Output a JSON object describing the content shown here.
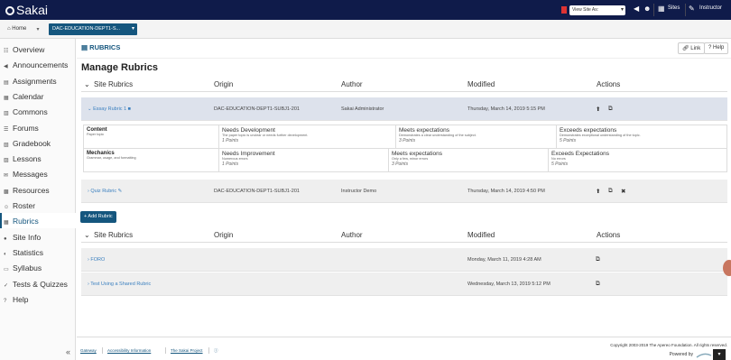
{
  "topbar": {
    "logo_text": "Sakai",
    "view_as": "View Site As:",
    "sites_label": "Sites",
    "user_label": "Instructor"
  },
  "sitebar": {
    "home_label": "Home",
    "site_label": "DAC-EDUCATION-DEPT1-S..."
  },
  "sidebar": {
    "items": [
      {
        "label": "Overview",
        "icon": "overview-icon"
      },
      {
        "label": "Announcements",
        "icon": "megaphone-icon"
      },
      {
        "label": "Assignments",
        "icon": "assignments-icon"
      },
      {
        "label": "Calendar",
        "icon": "calendar-icon"
      },
      {
        "label": "Commons",
        "icon": "commons-icon"
      },
      {
        "label": "Forums",
        "icon": "forums-icon"
      },
      {
        "label": "Gradebook",
        "icon": "gradebook-icon"
      },
      {
        "label": "Lessons",
        "icon": "lessons-icon"
      },
      {
        "label": "Messages",
        "icon": "messages-icon"
      },
      {
        "label": "Resources",
        "icon": "resources-icon"
      },
      {
        "label": "Roster",
        "icon": "roster-icon"
      },
      {
        "label": "Rubrics",
        "icon": "rubrics-icon",
        "active": true
      },
      {
        "label": "Site Info",
        "icon": "site-info-icon"
      },
      {
        "label": "Statistics",
        "icon": "statistics-icon"
      },
      {
        "label": "Syllabus",
        "icon": "syllabus-icon"
      },
      {
        "label": "Tests & Quizzes",
        "icon": "tests-icon"
      },
      {
        "label": "Help",
        "icon": "help-icon"
      }
    ],
    "collapse_glyph": "«"
  },
  "tool": {
    "title": "RUBRICS",
    "link_label": "Link",
    "help_label": "Help",
    "page_title": "Manage Rubrics"
  },
  "columns": {
    "name": "Site Rubrics",
    "origin": "Origin",
    "author": "Author",
    "modified": "Modified",
    "actions": "Actions"
  },
  "site_rubrics": [
    {
      "name": "Essay Rubric 1",
      "origin": "DAC-EDUCATION-DEPT1-SUBJ1-201",
      "author": "Sakai Administrator",
      "modified": "Thursday, March 14, 2019 5:15 PM"
    },
    {
      "name": "Quiz Rubric",
      "origin": "DAC-EDUCATION-DEPT1-SUBJ1-201",
      "author": "Instructor Demo",
      "modified": "Thursday, March 14, 2019 4:50 PM"
    }
  ],
  "criteria": [
    {
      "name": "Content",
      "desc": "Paper topic",
      "ratings": [
        {
          "title": "Needs Development",
          "desc": "The paper topic is unclear or needs further development.",
          "points": "1 Points"
        },
        {
          "title": "Meets expectations",
          "desc": "Demonstrates a clear understanding of the subject.",
          "points": "3 Points"
        },
        {
          "title": "Exceeds expectations",
          "desc": "Demonstrates exceptional understanding of the topic.",
          "points": "5 Points"
        }
      ]
    },
    {
      "name": "Mechanics",
      "desc": "Grammar, usage, and formatting",
      "ratings": [
        {
          "title": "Needs Improvement",
          "desc": "Numerous errors",
          "points": "1 Points"
        },
        {
          "title": "Meets expectations",
          "desc": "Only a few, minor errors",
          "points": "3 Points"
        },
        {
          "title": "Exceeds Expectations",
          "desc": "No errors",
          "points": "5 Points"
        }
      ]
    }
  ],
  "add_rubric_label": "+ Add Rubric",
  "shared_rubrics": [
    {
      "name": "FORO",
      "modified": "Monday, March 11, 2019 4:28 AM"
    },
    {
      "name": "Test Using a Shared Rubric",
      "modified": "Wednesday, March 13, 2019 5:12 PM"
    }
  ],
  "footer": {
    "links": [
      "Gateway",
      "Accessibility Information",
      "The Sakai Project"
    ],
    "copyright": "Copyright 2003-2019 The Apereo Foundation. All rights reserved.",
    "powered_by": "Powered by"
  },
  "colors": {
    "brand": "#0f1b4a",
    "accent": "#15567e",
    "link": "#3a7fbf"
  }
}
